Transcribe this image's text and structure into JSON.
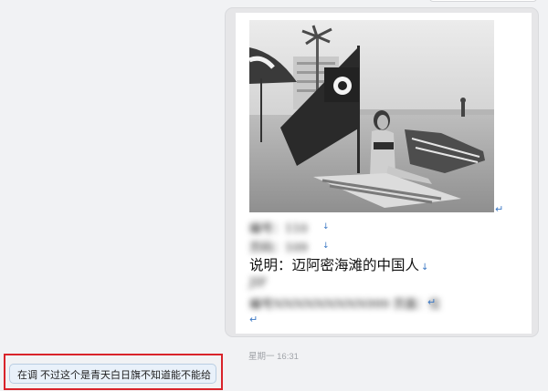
{
  "message": {
    "caption": "说明：迈阿密海滩的中国人",
    "blurred_lines": [
      "编号：110",
      "页码：109",
      "JIF",
      "编号NNNNNNNNN999 页面：位"
    ],
    "timestamp": "星期一 16:31",
    "return_glyph": "↵",
    "down_glyph": "↓"
  },
  "reply": {
    "text": "在调  不过这个是青天白日旗不知道能不能给"
  },
  "colors": {
    "background": "#f1f2f4",
    "highlight": "#d9232a",
    "reply_bubble": "#e9f1fa",
    "return_mark": "#3b78c4"
  }
}
